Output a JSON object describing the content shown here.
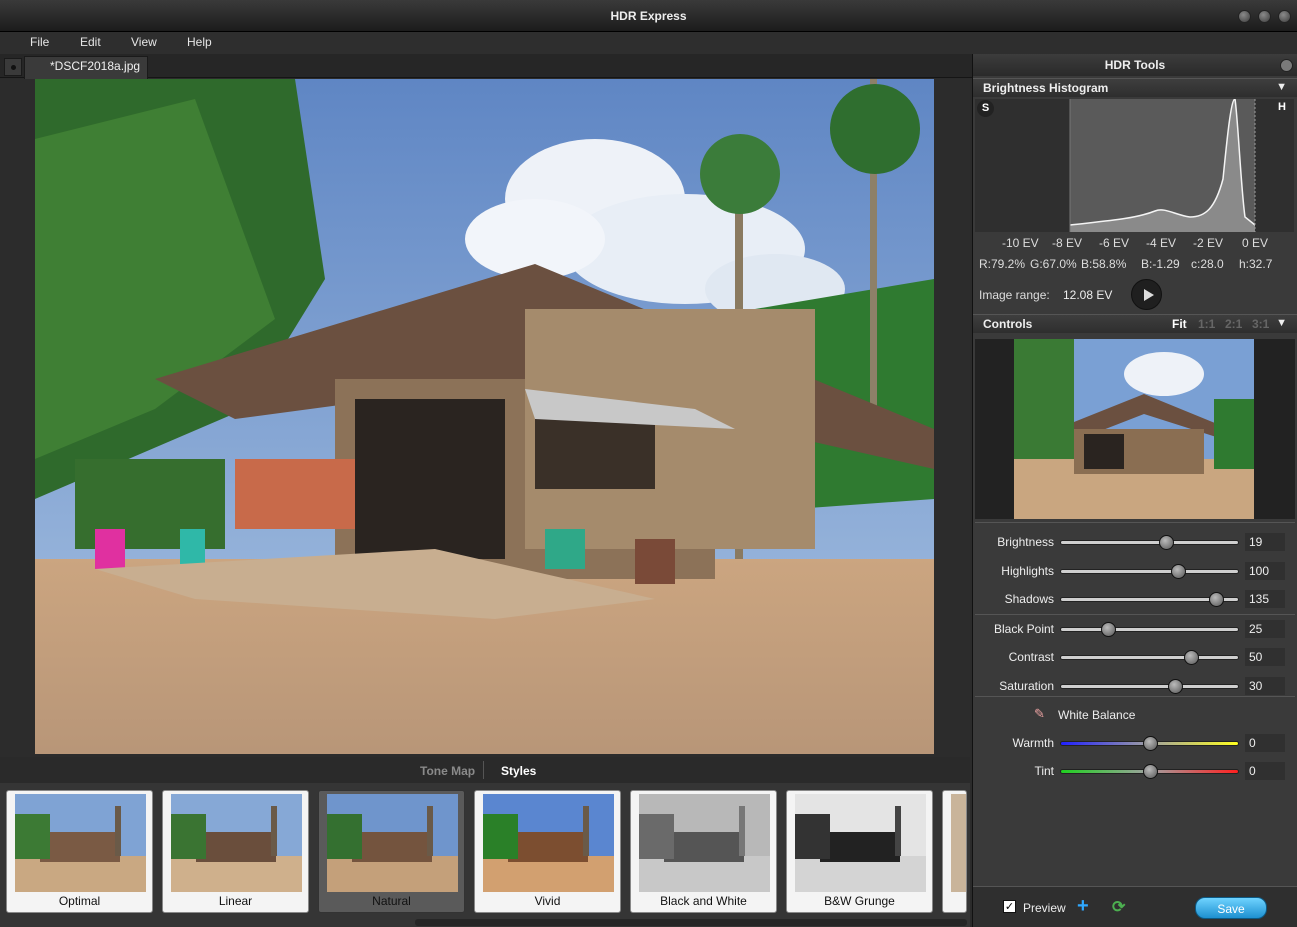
{
  "app": {
    "title": "HDR Express"
  },
  "menu": [
    "File",
    "Edit",
    "View",
    "Help"
  ],
  "document_tab": "*DSCF2018a.jpg",
  "bottom_tabs": {
    "tone_map": "Tone Map",
    "styles": "Styles"
  },
  "styles": [
    {
      "label": "Optimal",
      "selected": false
    },
    {
      "label": "Linear",
      "selected": false
    },
    {
      "label": "Natural",
      "selected": true
    },
    {
      "label": "Vivid",
      "selected": false
    },
    {
      "label": "Black and White",
      "selected": false
    },
    {
      "label": "B&W Grunge",
      "selected": false
    }
  ],
  "panel": {
    "title": "HDR Tools",
    "histogram": {
      "title": "Brightness Histogram",
      "shadow_btn": "S",
      "highlight_btn": "H",
      "ev_labels": [
        "-10 EV",
        "-8 EV",
        "-6 EV",
        "-4 EV",
        "-2 EV",
        "0 EV"
      ],
      "readout": {
        "r": "R:79.2%",
        "g": "G:67.0%",
        "b_pct": "B:58.8%",
        "b": "B:-1.29",
        "c": "c:28.0",
        "h": "h:32.7"
      },
      "image_range_label": "Image range:",
      "image_range_value": "12.08 EV"
    },
    "controls": {
      "title": "Controls",
      "zoom": [
        "Fit",
        "1:1",
        "2:1",
        "3:1"
      ],
      "sliders": [
        {
          "label": "Brightness",
          "value": "19",
          "pos": 0.59
        },
        {
          "label": "Highlights",
          "value": "100",
          "pos": 0.66
        },
        {
          "label": "Shadows",
          "value": "135",
          "pos": 0.87
        },
        {
          "label": "Black Point",
          "value": "25",
          "pos": 0.27
        },
        {
          "label": "Contrast",
          "value": "50",
          "pos": 0.73
        },
        {
          "label": "Saturation",
          "value": "30",
          "pos": 0.64
        }
      ],
      "white_balance": "White Balance",
      "wb_sliders": [
        {
          "label": "Warmth",
          "value": "0",
          "pos": 0.5
        },
        {
          "label": "Tint",
          "value": "0",
          "pos": 0.5
        }
      ]
    },
    "footer": {
      "preview_label": "Preview",
      "preview_checked": true,
      "save": "Save"
    }
  }
}
